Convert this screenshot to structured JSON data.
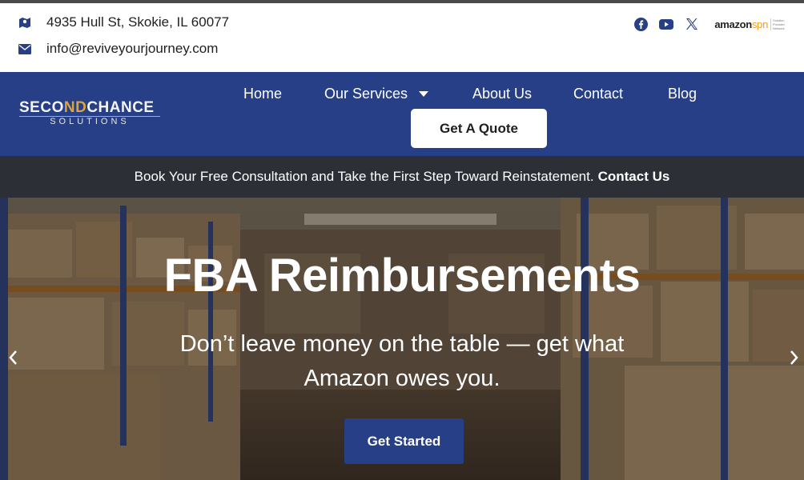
{
  "topbar": {
    "address": "4935 Hull St, Skokie, IL 60077",
    "email": "info@reviveyourjourney.com",
    "socials": [
      {
        "name": "facebook-icon"
      },
      {
        "name": "youtube-icon"
      },
      {
        "name": "x-icon"
      }
    ],
    "spn_logo": {
      "primary": "amazon",
      "accent": "spn",
      "sub": "Solution Provider Network"
    }
  },
  "logo": {
    "part1": "SECO",
    "part2": "ND",
    "part3": "CHANCE",
    "sub": "SOLUTIONS"
  },
  "nav": {
    "items": [
      "Home",
      "Our Services",
      "About Us",
      "Contact",
      "Blog"
    ],
    "cta": "Get A Quote"
  },
  "promo": {
    "text": "Book Your Free Consultation and Take the First Step Toward Reinstatement.",
    "link": "Contact Us"
  },
  "hero": {
    "title": "FBA Reimbursements",
    "subtitle": "Don’t leave money on the table — get what Amazon owes you.",
    "button": "Get Started"
  },
  "colors": {
    "brand_blue": "#263f86",
    "promo_bg": "#2c2f36",
    "gold": "#d9a441"
  }
}
